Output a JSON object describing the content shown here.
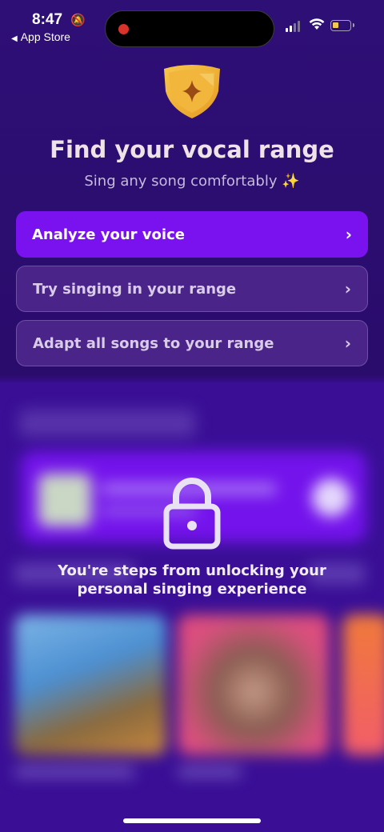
{
  "status_bar": {
    "time": "8:47",
    "back_label": "App Store",
    "icons": [
      "bell-slash-icon",
      "recording-dot-icon",
      "cellular-signal-icon",
      "wifi-icon",
      "battery-low-icon"
    ],
    "battery_color": "#f2c94c"
  },
  "header": {
    "badge_icon": "star-shield-icon",
    "title": "Find your vocal range",
    "subtitle": "Sing any song comfortably ✨"
  },
  "options": [
    {
      "label": "Analyze your voice",
      "style": "primary",
      "icon": "chevron-right-icon"
    },
    {
      "label": "Try singing in your range",
      "style": "secondary",
      "icon": "chevron-right-icon"
    },
    {
      "label": "Adapt all songs to your range",
      "style": "secondary",
      "icon": "chevron-right-icon"
    }
  ],
  "locked_section": {
    "icon": "lock-icon",
    "message": "You're steps from unlocking your personal singing experience"
  },
  "colors": {
    "background": "#2e0f76",
    "primary_button": "#7a12f0",
    "secondary_button": "#4a2488",
    "badge_gold": "#f2b53a"
  }
}
